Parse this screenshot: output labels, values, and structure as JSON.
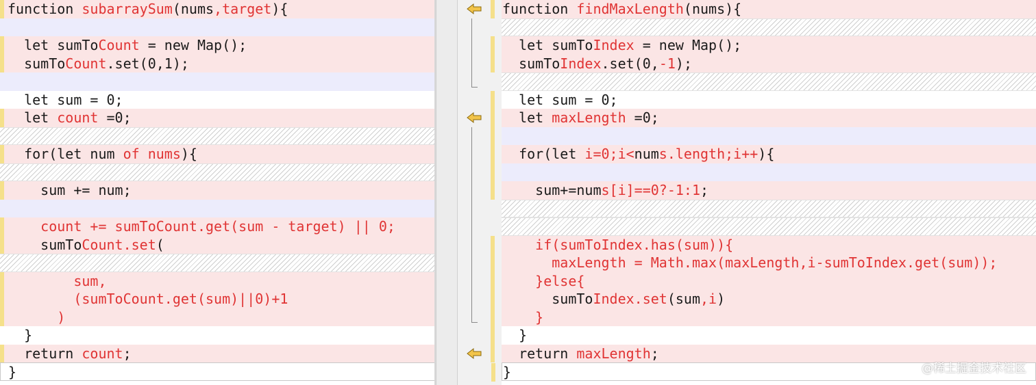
{
  "left": {
    "lines": [
      {
        "kind": "changed",
        "marker": true,
        "segs": [
          {
            "t": "function ",
            "c": ""
          },
          {
            "t": "subarraySum",
            "c": "red"
          },
          {
            "t": "(nums",
            "c": ""
          },
          {
            "t": ",target",
            "c": "red"
          },
          {
            "t": "){",
            "c": ""
          }
        ]
      },
      {
        "kind": "inserted",
        "marker": false,
        "segs": []
      },
      {
        "kind": "changed",
        "marker": true,
        "segs": [
          {
            "t": "  let sumTo",
            "c": ""
          },
          {
            "t": "Count",
            "c": "red"
          },
          {
            "t": " = new Map();",
            "c": ""
          }
        ]
      },
      {
        "kind": "changed",
        "marker": true,
        "segs": [
          {
            "t": "  sumTo",
            "c": ""
          },
          {
            "t": "Count",
            "c": "red"
          },
          {
            "t": ".set(0,1);",
            "c": ""
          }
        ]
      },
      {
        "kind": "inserted",
        "marker": false,
        "segs": []
      },
      {
        "kind": "plain",
        "marker": false,
        "segs": [
          {
            "t": "  let sum = 0;",
            "c": ""
          }
        ]
      },
      {
        "kind": "changed",
        "marker": true,
        "segs": [
          {
            "t": "  let ",
            "c": ""
          },
          {
            "t": "count",
            "c": "red"
          },
          {
            "t": " =0;",
            "c": ""
          }
        ]
      },
      {
        "kind": "filler",
        "marker": false,
        "segs": []
      },
      {
        "kind": "changed",
        "marker": true,
        "segs": [
          {
            "t": "  for(let ",
            "c": ""
          },
          {
            "t": "num",
            "c": ""
          },
          {
            "t": " of nums",
            "c": "red"
          },
          {
            "t": "){",
            "c": ""
          }
        ]
      },
      {
        "kind": "filler",
        "marker": false,
        "segs": []
      },
      {
        "kind": "changed",
        "marker": true,
        "segs": [
          {
            "t": "    sum += num;",
            "c": ""
          }
        ]
      },
      {
        "kind": "inserted",
        "marker": false,
        "segs": []
      },
      {
        "kind": "changed",
        "marker": true,
        "segs": [
          {
            "t": "    count += sumToCount.get(sum - target) || 0;",
            "c": "red"
          }
        ]
      },
      {
        "kind": "changed",
        "marker": true,
        "segs": [
          {
            "t": "    sumTo",
            "c": ""
          },
          {
            "t": "Count.set",
            "c": "red"
          },
          {
            "t": "(",
            "c": ""
          }
        ]
      },
      {
        "kind": "filler",
        "marker": false,
        "segs": []
      },
      {
        "kind": "changed",
        "marker": true,
        "segs": [
          {
            "t": "        sum,",
            "c": "red"
          }
        ]
      },
      {
        "kind": "changed",
        "marker": true,
        "segs": [
          {
            "t": "        (sumTo",
            "c": "red"
          },
          {
            "t": "Count",
            "c": "red"
          },
          {
            "t": ".get(sum)",
            "c": "red"
          },
          {
            "t": "||0)+1",
            "c": "red"
          }
        ]
      },
      {
        "kind": "changed",
        "marker": true,
        "segs": [
          {
            "t": "      )",
            "c": "red"
          }
        ]
      },
      {
        "kind": "plain",
        "marker": false,
        "segs": [
          {
            "t": "  }",
            "c": ""
          }
        ]
      },
      {
        "kind": "changed",
        "marker": true,
        "segs": [
          {
            "t": "  return ",
            "c": ""
          },
          {
            "t": "count",
            "c": "red"
          },
          {
            "t": ";",
            "c": ""
          }
        ]
      },
      {
        "kind": "last",
        "marker": false,
        "segs": [
          {
            "t": "}",
            "c": ""
          }
        ]
      }
    ]
  },
  "right": {
    "lines": [
      {
        "kind": "changed",
        "marker": true,
        "segs": [
          {
            "t": "function ",
            "c": ""
          },
          {
            "t": "findMaxLength",
            "c": "red"
          },
          {
            "t": "(nums){",
            "c": ""
          }
        ]
      },
      {
        "kind": "filler",
        "marker": false,
        "segs": []
      },
      {
        "kind": "changed",
        "marker": true,
        "segs": [
          {
            "t": "  let sumTo",
            "c": ""
          },
          {
            "t": "Index",
            "c": "red"
          },
          {
            "t": " = new Map();",
            "c": ""
          }
        ]
      },
      {
        "kind": "changed",
        "marker": true,
        "segs": [
          {
            "t": "  sumTo",
            "c": ""
          },
          {
            "t": "Index",
            "c": "red"
          },
          {
            "t": ".set(0,",
            "c": ""
          },
          {
            "t": "-1",
            "c": "red"
          },
          {
            "t": ");",
            "c": ""
          }
        ]
      },
      {
        "kind": "filler",
        "marker": false,
        "segs": []
      },
      {
        "kind": "plain",
        "marker": true,
        "segs": [
          {
            "t": "  let sum = 0;",
            "c": ""
          }
        ]
      },
      {
        "kind": "changed",
        "marker": true,
        "segs": [
          {
            "t": "  let ",
            "c": ""
          },
          {
            "t": "maxLength",
            "c": "red"
          },
          {
            "t": " =0;",
            "c": ""
          }
        ]
      },
      {
        "kind": "inserted",
        "marker": true,
        "segs": []
      },
      {
        "kind": "changed",
        "marker": true,
        "segs": [
          {
            "t": "  for(let ",
            "c": ""
          },
          {
            "t": "i=0;i<",
            "c": "red"
          },
          {
            "t": "num",
            "c": ""
          },
          {
            "t": "s.length;i++",
            "c": "red"
          },
          {
            "t": "){",
            "c": ""
          }
        ]
      },
      {
        "kind": "inserted",
        "marker": true,
        "segs": []
      },
      {
        "kind": "changed",
        "marker": true,
        "segs": [
          {
            "t": "    sum+=num",
            "c": ""
          },
          {
            "t": "s[i]==0?-1:1",
            "c": "red"
          },
          {
            "t": ";",
            "c": ""
          }
        ]
      },
      {
        "kind": "filler",
        "marker": false,
        "segs": []
      },
      {
        "kind": "filler",
        "marker": false,
        "segs": []
      },
      {
        "kind": "changed",
        "marker": true,
        "segs": [
          {
            "t": "    if(sumToIndex.has(sum)){",
            "c": "red"
          }
        ]
      },
      {
        "kind": "changed",
        "marker": true,
        "segs": [
          {
            "t": "      maxLength = Math.max(maxLength,i-sumToIndex.get(sum));",
            "c": "red"
          }
        ]
      },
      {
        "kind": "changed",
        "marker": true,
        "segs": [
          {
            "t": "    }else{",
            "c": "red"
          }
        ]
      },
      {
        "kind": "changed",
        "marker": true,
        "segs": [
          {
            "t": "      sumTo",
            "c": ""
          },
          {
            "t": "Index.set",
            "c": "red"
          },
          {
            "t": "(sum",
            "c": ""
          },
          {
            "t": ",i",
            "c": "red"
          },
          {
            "t": ")",
            "c": ""
          }
        ]
      },
      {
        "kind": "changed",
        "marker": true,
        "segs": [
          {
            "t": "    }",
            "c": "red"
          }
        ]
      },
      {
        "kind": "plain",
        "marker": true,
        "segs": [
          {
            "t": "  }",
            "c": ""
          }
        ]
      },
      {
        "kind": "changed",
        "marker": true,
        "segs": [
          {
            "t": "  return ",
            "c": ""
          },
          {
            "t": "maxLength",
            "c": "red"
          },
          {
            "t": ";",
            "c": ""
          }
        ]
      },
      {
        "kind": "last",
        "marker": true,
        "segs": [
          {
            "t": "}",
            "c": ""
          }
        ]
      }
    ]
  },
  "gutter": {
    "arrow_icon": "merge-left-arrow-icon",
    "arrow_color": "#f2c44a"
  },
  "watermark": {
    "text": "@稀土掘金技术社区"
  },
  "colors": {
    "changed_bg": "#fbe5e5",
    "inserted_bg": "#ececfc",
    "token_red": "#e03434",
    "marker": "#f5e08a"
  }
}
